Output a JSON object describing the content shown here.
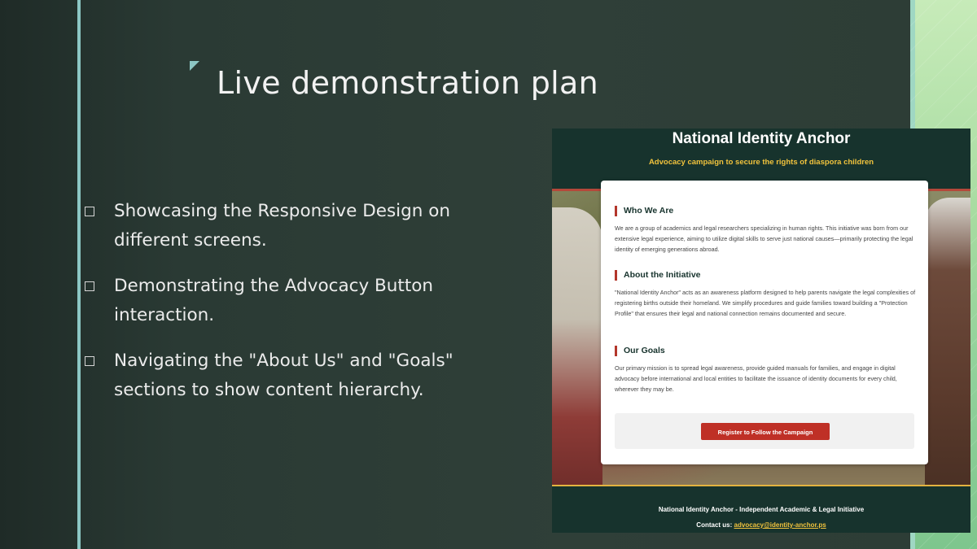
{
  "slide": {
    "title": "Live demonstration plan",
    "bullets": [
      {
        "text": "Showcasing the Responsive Design on different screens."
      },
      {
        "text": "Demonstrating the Advocacy Button interaction."
      },
      {
        "text": "Navigating the \"About Us\" and \"Goals\" sections to show content hierarchy."
      }
    ]
  },
  "website": {
    "title": "National Identity Anchor",
    "subtitle": "Advocacy campaign to secure the rights of diaspora children",
    "sections": [
      {
        "heading": "Who We Are",
        "body": "We are a group of academics and legal researchers specializing in human rights. This initiative was born from our extensive legal experience, aiming to utilize digital skills to serve just national causes—primarily protecting the legal identity of emerging generations abroad."
      },
      {
        "heading": "About the Initiative",
        "body": "\"National Identity Anchor\" acts as an awareness platform designed to help parents navigate the legal complexities of registering births outside their homeland. We simplify procedures and guide families toward building a \"Protection Profile\" that ensures their legal and national connection remains documented and secure."
      },
      {
        "heading": "Our Goals",
        "body": "Our primary mission is to spread legal awareness, provide guided manuals for families, and engage in digital advocacy before international and local entities to facilitate the issuance of identity documents for every child, wherever they may be."
      }
    ],
    "cta_label": "Register to Follow the Campaign",
    "footer": {
      "line": "National Identity Anchor - Independent Academic & Legal Initiative",
      "contact_label": "Contact us:",
      "email": "advocacy@identity-anchor.ps"
    }
  },
  "colors": {
    "slide_bg": "#2d3d36",
    "accent_teal": "#8cc7c4",
    "site_header": "#17332d",
    "site_subtitle": "#f1c33d",
    "cta": "#bf3026",
    "section_bar": "#b3362b"
  }
}
